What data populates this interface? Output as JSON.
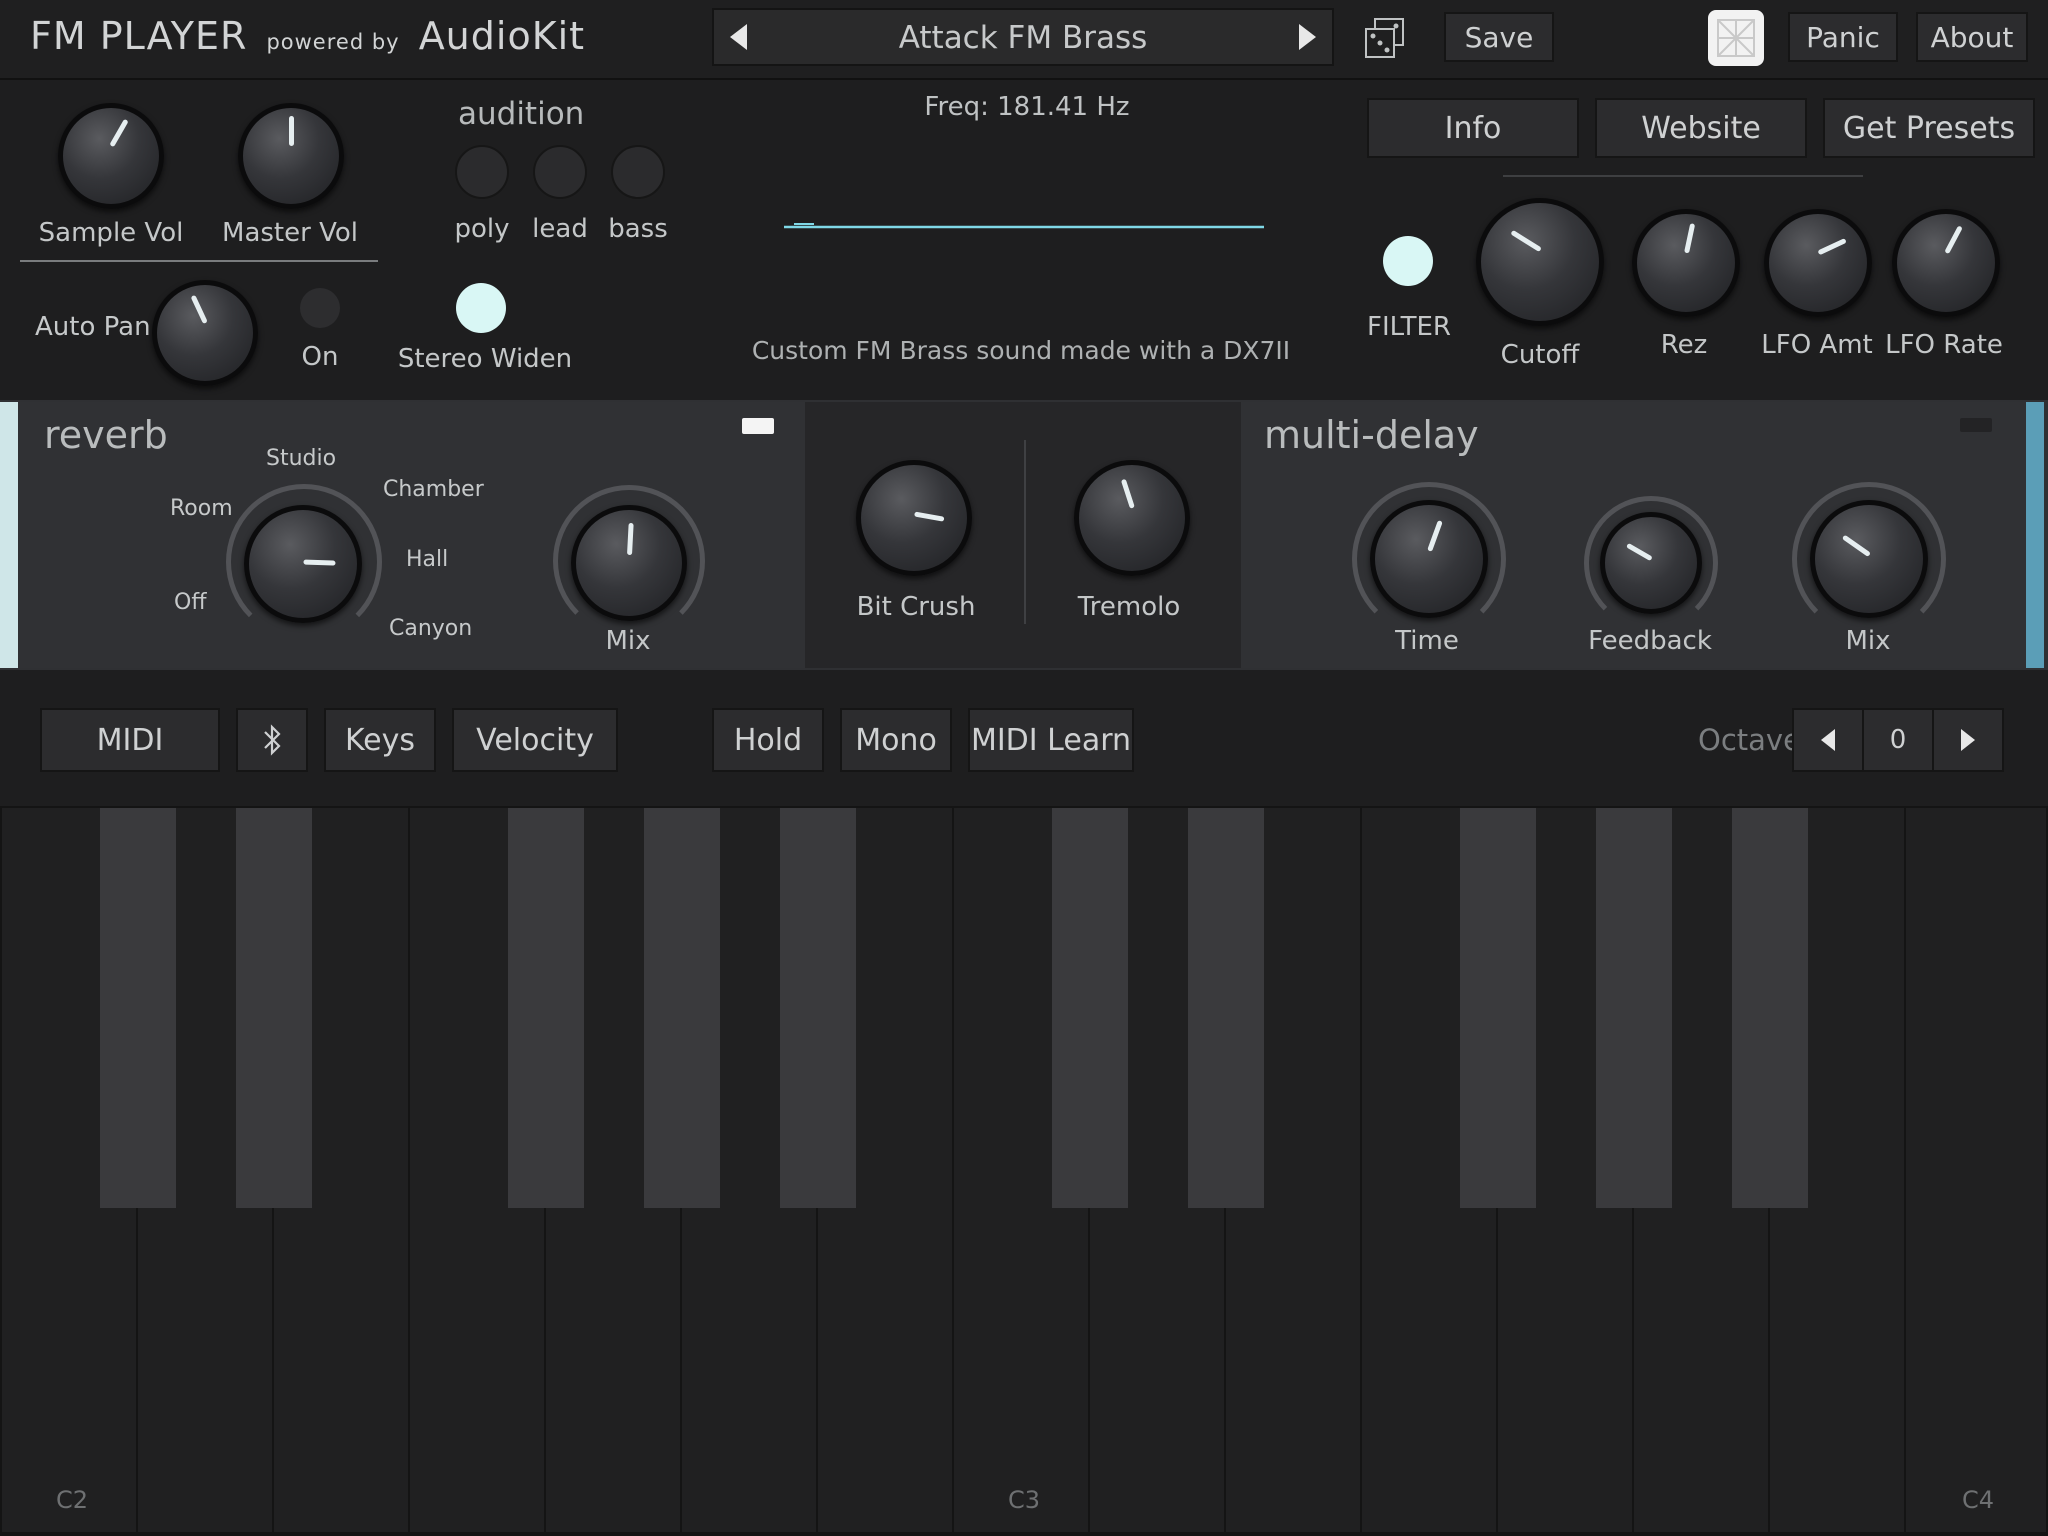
{
  "header": {
    "app_name": "FM PLAYER",
    "powered_by": "powered by",
    "brand": "AudioKit",
    "preset_name": "Attack FM Brass",
    "save_label": "Save",
    "panic_label": "Panic",
    "about_label": "About"
  },
  "main_controls": {
    "sample_vol_label": "Sample Vol",
    "master_vol_label": "Master Vol",
    "auto_pan_label": "Auto Pan",
    "auto_pan_on_label": "On",
    "audition_title": "audition",
    "audition_options": [
      "poly",
      "lead",
      "bass"
    ],
    "stereo_widen_label": "Stereo Widen"
  },
  "display": {
    "freq_readout": "Freq: 181.41 Hz",
    "preset_description": "Custom FM Brass sound made with a DX7II"
  },
  "info_buttons": {
    "info_label": "Info",
    "website_label": "Website",
    "get_presets_label": "Get Presets"
  },
  "filter_section": {
    "filter_label": "FILTER",
    "cutoff_label": "Cutoff",
    "rez_label": "Rez",
    "lfo_amt_label": "LFO Amt",
    "lfo_rate_label": "LFO Rate"
  },
  "reverb": {
    "title": "reverb",
    "types": [
      "Off",
      "Room",
      "Studio",
      "Chamber",
      "Hall",
      "Canyon"
    ],
    "selected_type": "Hall",
    "mix_label": "Mix"
  },
  "middle_effects": {
    "bit_crush_label": "Bit Crush",
    "tremolo_label": "Tremolo"
  },
  "multi_delay": {
    "title": "multi-delay",
    "time_label": "Time",
    "feedback_label": "Feedback",
    "mix_label": "Mix"
  },
  "toolbar": {
    "midi_label": "MIDI",
    "bluetooth_icon": "bluetooth-icon",
    "keys_label": "Keys",
    "velocity_label": "Velocity",
    "hold_label": "Hold",
    "mono_label": "Mono",
    "midi_learn_label": "MIDI Learn",
    "octave_label": "Octave",
    "octave_value": "0"
  },
  "keyboard": {
    "note_labels": [
      "C2",
      "C3",
      "C4"
    ]
  },
  "colors": {
    "accent_cyan": "#d9f7f5",
    "background": "#1e1e1f",
    "panel": "#303134",
    "delay_accent": "#5b9eb7"
  }
}
